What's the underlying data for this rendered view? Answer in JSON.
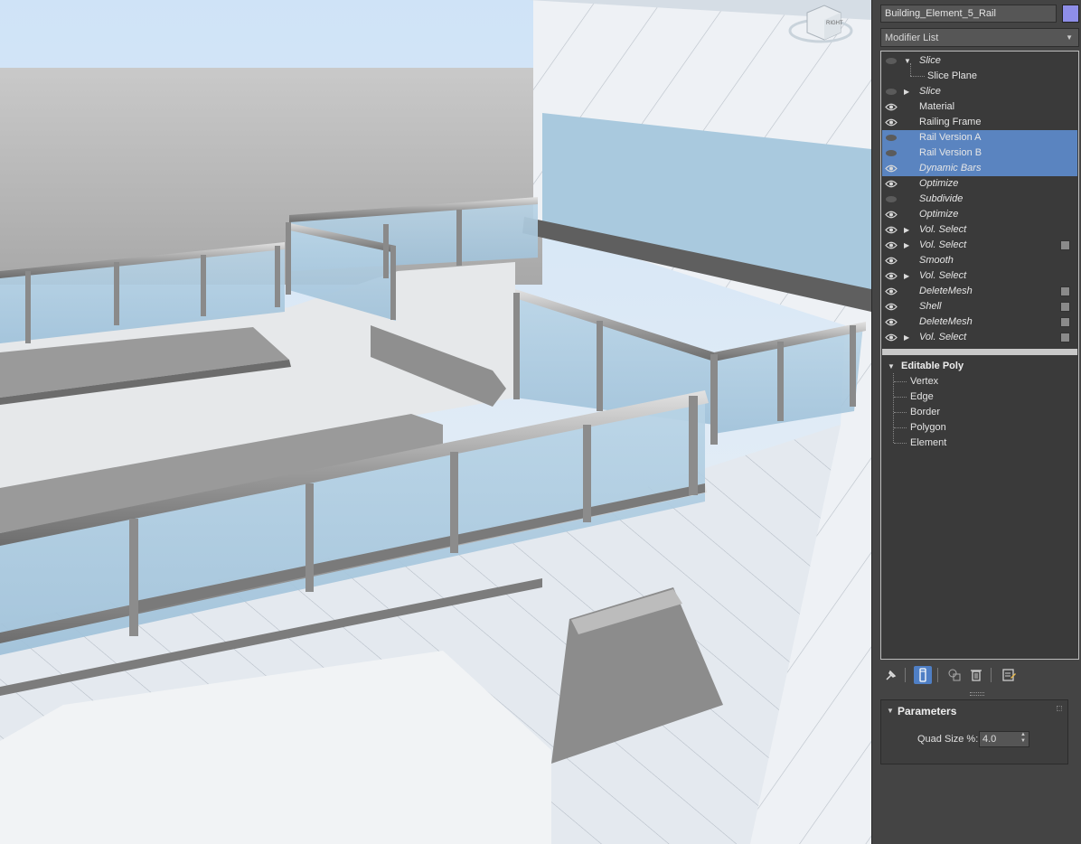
{
  "object": {
    "name": "Building_Element_5_Rail",
    "color": "#8e8ee8"
  },
  "modifier_list": {
    "label": "Modifier List"
  },
  "viewcube": {
    "face_label": "RIGHT"
  },
  "stack": [
    {
      "label": "Slice",
      "italic": true,
      "expanded": true,
      "eye": false,
      "selected": false,
      "checkbox": false
    },
    {
      "label": "Slice Plane",
      "sub": true
    },
    {
      "label": "Slice",
      "italic": true,
      "collapsed": true,
      "eye": false,
      "selected": false,
      "checkbox": false
    },
    {
      "label": "Material",
      "italic": false,
      "eye": true,
      "selected": false,
      "checkbox": false
    },
    {
      "label": "Railing Frame",
      "italic": false,
      "eye": true,
      "selected": false,
      "checkbox": false
    },
    {
      "label": "Rail Version A",
      "italic": false,
      "eye": false,
      "selected": true,
      "checkbox": false
    },
    {
      "label": "Rail Version B",
      "italic": false,
      "eye": false,
      "selected": true,
      "checkbox": false
    },
    {
      "label": "Dynamic Bars",
      "italic": true,
      "eye": true,
      "selected": true,
      "checkbox": false
    },
    {
      "label": "Optimize",
      "italic": true,
      "eye": true,
      "selected": false,
      "checkbox": false
    },
    {
      "label": "Subdivide",
      "italic": true,
      "eye": false,
      "selected": false,
      "checkbox": false
    },
    {
      "label": "Optimize",
      "italic": true,
      "eye": true,
      "selected": false,
      "checkbox": false
    },
    {
      "label": "Vol. Select",
      "italic": true,
      "collapsed": true,
      "eye": true,
      "selected": false,
      "checkbox": false
    },
    {
      "label": "Vol. Select",
      "italic": true,
      "collapsed": true,
      "eye": true,
      "selected": false,
      "checkbox": true
    },
    {
      "label": "Smooth",
      "italic": true,
      "eye": true,
      "selected": false,
      "checkbox": false
    },
    {
      "label": "Vol. Select",
      "italic": true,
      "collapsed": true,
      "eye": true,
      "selected": false,
      "checkbox": false
    },
    {
      "label": "DeleteMesh",
      "italic": true,
      "eye": true,
      "selected": false,
      "checkbox": true
    },
    {
      "label": "Shell",
      "italic": true,
      "eye": true,
      "selected": false,
      "checkbox": true
    },
    {
      "label": "DeleteMesh",
      "italic": true,
      "eye": true,
      "selected": false,
      "checkbox": true
    },
    {
      "label": "Vol. Select",
      "italic": true,
      "collapsed": true,
      "eye": true,
      "selected": false,
      "checkbox": true
    }
  ],
  "editable_poly": {
    "title": "Editable Poly",
    "items": [
      "Vertex",
      "Edge",
      "Border",
      "Polygon",
      "Element"
    ]
  },
  "stack_tools": [
    {
      "name": "pin-stack-icon",
      "active": false
    },
    {
      "name": "show-end-result-icon",
      "active": true
    },
    {
      "name": "make-unique-icon",
      "active": false
    },
    {
      "name": "remove-modifier-icon",
      "active": false
    },
    {
      "name": "configure-modifier-sets-icon",
      "active": false
    }
  ],
  "parameters": {
    "title": "Parameters",
    "quad_size_label": "Quad Size %:",
    "quad_size_value": "4.0"
  },
  "colors": {
    "selection": "#5a84c0",
    "panel": "#444444"
  }
}
